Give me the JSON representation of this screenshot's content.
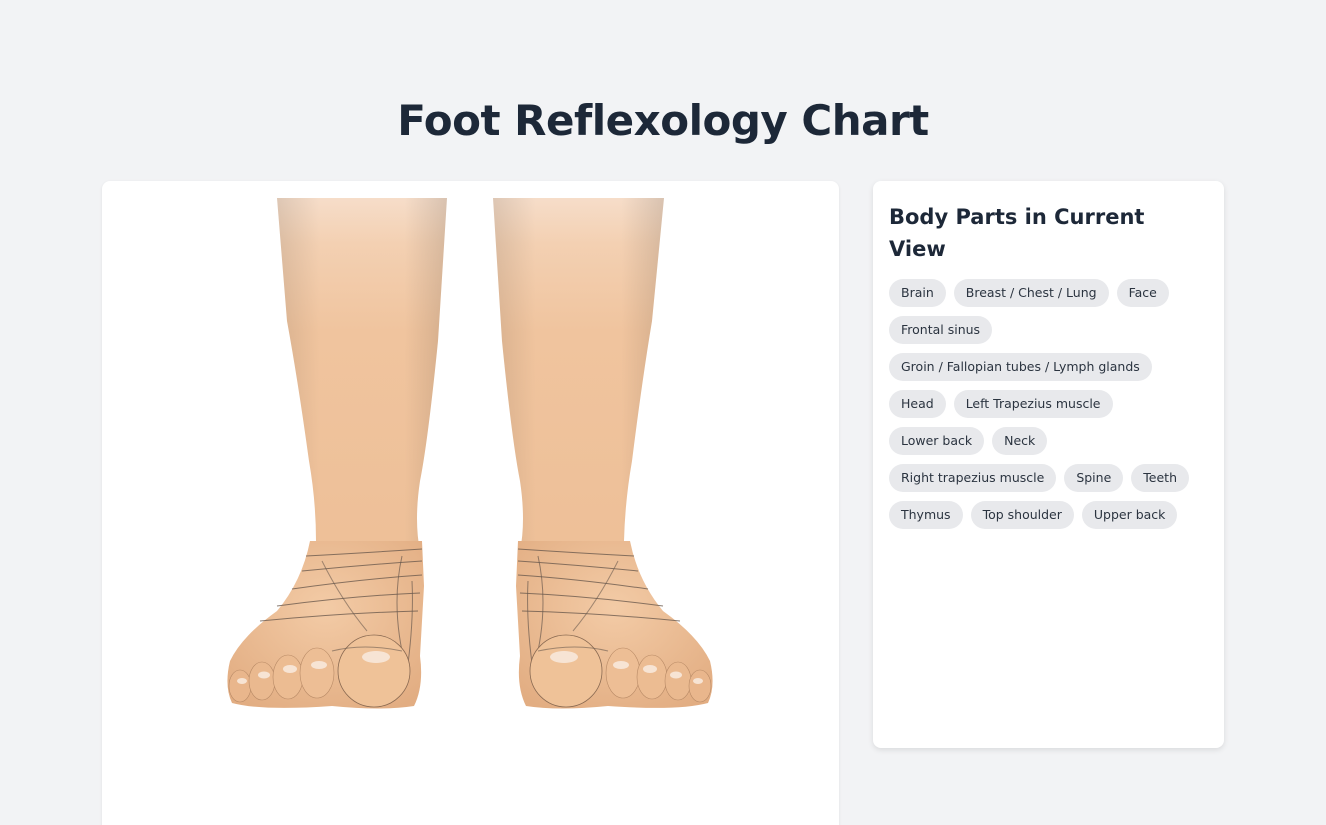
{
  "page": {
    "title": "Foot Reflexology Chart"
  },
  "viewer": {
    "subject": "Front view of both feet with reflexology zone lines",
    "skin_color": "#f0c49e",
    "zone_line_color": "#6b5a4e"
  },
  "sidebar": {
    "heading": "Body Parts in Current View",
    "tags": [
      "Brain",
      "Breast / Chest / Lung",
      "Face",
      "Frontal sinus",
      "Groin / Fallopian tubes / Lymph glands",
      "Head",
      "Left Trapezius muscle",
      "Lower back",
      "Neck",
      "Right trapezius muscle",
      "Spine",
      "Teeth",
      "Thymus",
      "Top shoulder",
      "Upper back"
    ]
  },
  "colors": {
    "background": "#f2f3f5",
    "card": "#ffffff",
    "title_text": "#1d2838",
    "tag_background": "#e8e9ec",
    "tag_text": "#2b3440"
  }
}
